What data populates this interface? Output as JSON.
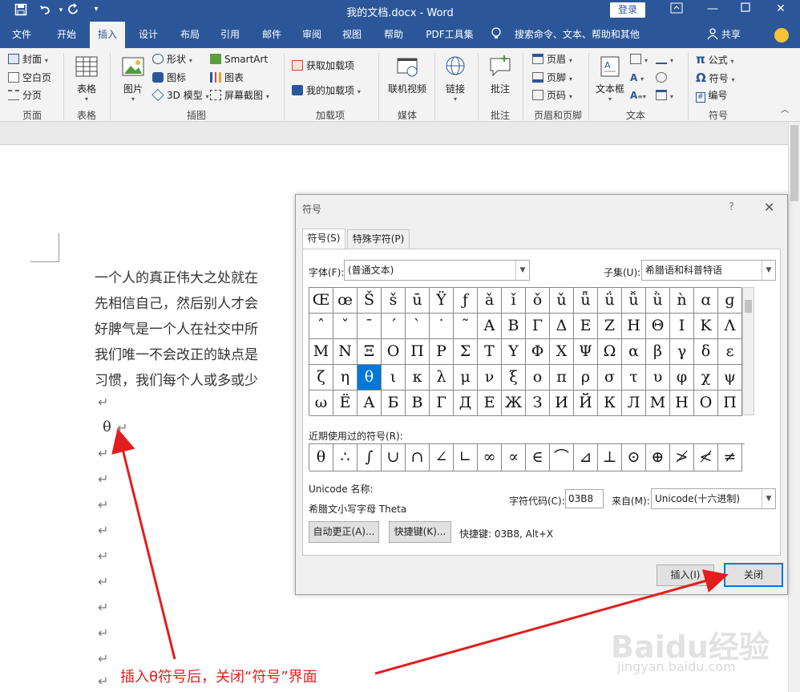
{
  "titlebar": {
    "title": "我的文档.docx - Word",
    "login": "登录",
    "icons": [
      "save-icon",
      "undo-icon",
      "redo-icon",
      "customize-icon"
    ]
  },
  "tabs": [
    "文件",
    "开始",
    "插入",
    "设计",
    "布局",
    "引用",
    "邮件",
    "审阅",
    "视图",
    "帮助",
    "PDF工具集"
  ],
  "active_tab": "插入",
  "tell_me": "搜索命令、文本、帮助和其他",
  "share": "共享",
  "ribbon": {
    "page_group": {
      "items": [
        "封面",
        "空白页",
        "分页"
      ],
      "label": "页面"
    },
    "table_group": {
      "button": "表格",
      "label": "表格"
    },
    "illus_group": {
      "picture": "图片",
      "shape": "形状",
      "icon": "图标",
      "model3d": "3D 模型",
      "smartart": "SmartArt",
      "chart": "图表",
      "screenshot": "屏幕截图",
      "label": "插图"
    },
    "addin_group": {
      "get": "获取加载项",
      "mine": "我的加载项",
      "label": "加载项"
    },
    "media_group": {
      "video": "联机视频",
      "label": "媒体"
    },
    "link_group": {
      "link": "链接"
    },
    "comment_group": {
      "comment": "批注",
      "label": "批注"
    },
    "hf_group": {
      "header": "页眉",
      "footer": "页脚",
      "pagenum": "页码",
      "label": "页眉和页脚"
    },
    "text_group": {
      "textbox": "文本框",
      "label": "文本"
    },
    "symbol_group": {
      "equation": "公式",
      "symbol": "符号",
      "number": "编号",
      "label": "符号"
    }
  },
  "doc_lines": [
    "一个人的真正伟大之处就在",
    "先相信自己，然后别人才会",
    "好脾气是一个人在社交中所",
    "我们唯一不会改正的缺点是",
    "习惯，我们每个人或多或少"
  ],
  "inserted_char": "θ",
  "para_mark": "↵",
  "dialog": {
    "title": "符号",
    "help": "?",
    "close": "✕",
    "tab_symbols": "符号(S)",
    "tab_special": "特殊字符(P)",
    "font_label": "字体(F):",
    "font_value": "(普通文本)",
    "subset_label": "子集(U):",
    "subset_value": "希腊语和科普特语",
    "symbols": [
      "Œ",
      "œ",
      "Š",
      "š",
      "ū",
      "Ÿ",
      "ƒ",
      "ǎ",
      "ǐ",
      "ǒ",
      "ǔ",
      "ǖ",
      "ǘ",
      "ǚ",
      "ǜ",
      "ǹ",
      "ɑ",
      "ɡ",
      "ˆ",
      "ˇ",
      "ˉ",
      "ˊ",
      "ˋ",
      "˙",
      "˜",
      "Α",
      "Β",
      "Γ",
      "Δ",
      "Ε",
      "Ζ",
      "Η",
      "Θ",
      "Ι",
      "Κ",
      "Λ",
      "Μ",
      "Ν",
      "Ξ",
      "Ο",
      "Π",
      "Ρ",
      "Σ",
      "Τ",
      "Υ",
      "Φ",
      "Χ",
      "Ψ",
      "Ω",
      "α",
      "β",
      "γ",
      "δ",
      "ε",
      "ζ",
      "η",
      "θ",
      "ι",
      "κ",
      "λ",
      "μ",
      "ν",
      "ξ",
      "ο",
      "π",
      "ρ",
      "σ",
      "τ",
      "υ",
      "φ",
      "χ",
      "ψ",
      "ω",
      "Ё",
      "А",
      "Б",
      "В",
      "Г",
      "Д",
      "Е",
      "Ж",
      "З",
      "И",
      "Й",
      "К",
      "Л",
      "М",
      "Н",
      "О",
      "П"
    ],
    "selected_symbol": "θ",
    "recent_label": "近期使用过的符号(R):",
    "recent": [
      "θ",
      "∴",
      "∫",
      "∪",
      "∩",
      "∠",
      "∟",
      "∞",
      "∝",
      "∈",
      "⌒",
      "⊿",
      "⊥",
      "⊙",
      "⊕",
      "≯",
      "≮",
      "≠"
    ],
    "unicode_name_label": "Unicode 名称:",
    "unicode_name": "希腊文小写字母 Theta",
    "char_code_label": "字符代码(C):",
    "char_code": "03B8",
    "from_label": "来自(M):",
    "from_value": "Unicode(十六进制)",
    "autocorrect": "自动更正(A)...",
    "shortcut_key_btn": "快捷键(K)...",
    "shortcut_info": "快捷键: 03B8, Alt+X",
    "insert": "插入(I)",
    "close_btn": "关闭"
  },
  "annotation": {
    "text": "插入θ符号后，关闭“符号”界面",
    "color": "#e21e1e"
  },
  "watermark": {
    "text": "Baidu经验",
    "sub": "jingyan.baidu.com"
  },
  "colors": {
    "word_blue": "#2b579a",
    "select_blue": "#0078d7"
  }
}
